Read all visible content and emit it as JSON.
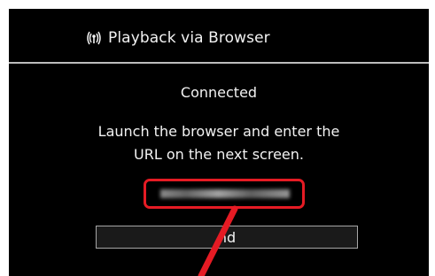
{
  "header": {
    "icon": "wireless-icon",
    "title": "Playback via Browser"
  },
  "status": {
    "text": "Connected"
  },
  "instruction": {
    "line1": "Launch the browser and enter the",
    "line2": "URL on the next screen."
  },
  "end_button": {
    "label": "nd"
  },
  "colors": {
    "screen_bg": "#000000",
    "text": "#f2f2f2",
    "divider": "#bdbdbd",
    "highlight": "#e51b24"
  }
}
